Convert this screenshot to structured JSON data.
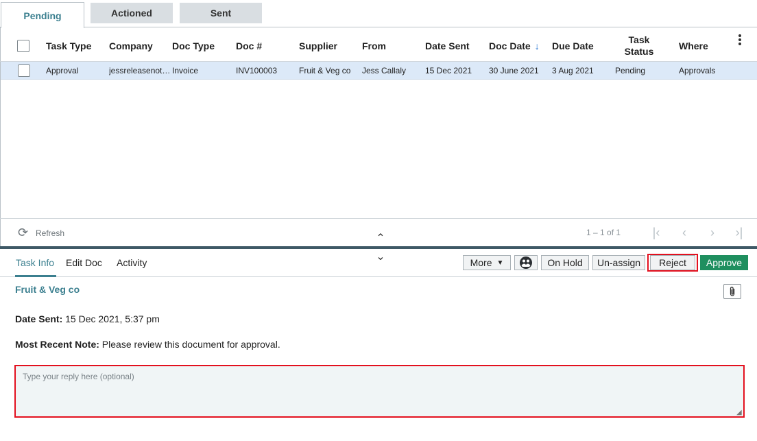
{
  "tabs": {
    "pending": "Pending",
    "actioned": "Actioned",
    "sent": "Sent"
  },
  "columns": {
    "task_type": "Task Type",
    "company": "Company",
    "doc_type": "Doc Type",
    "doc_num": "Doc #",
    "supplier": "Supplier",
    "from": "From",
    "date_sent": "Date Sent",
    "doc_date": "Doc Date",
    "due_date": "Due Date",
    "task_status_1": "Task",
    "task_status_2": "Status",
    "where": "Where",
    "sort_icon": "arrow-down-icon"
  },
  "rows": [
    {
      "task_type": "Approval",
      "company": "jessreleasenot…",
      "doc_type": "Invoice",
      "doc_num": "INV100003",
      "supplier": "Fruit & Veg co",
      "from": "Jess Callaly",
      "date_sent": "15 Dec 2021",
      "doc_date": "30 June 2021",
      "due_date": "3 Aug 2021",
      "task_status": "Pending",
      "where": "Approvals"
    }
  ],
  "pager": {
    "refresh_label": "Refresh",
    "count": "1 – 1 of 1"
  },
  "detail_tabs": {
    "task_info": "Task Info",
    "edit_doc": "Edit Doc",
    "activity": "Activity"
  },
  "actions": {
    "more": "More",
    "on_hold": "On Hold",
    "unassign": "Un-assign",
    "reject": "Reject",
    "approve": "Approve"
  },
  "detail": {
    "supplier_name": "Fruit & Veg co",
    "date_sent_label": "Date Sent:",
    "date_sent_value": "15 Dec 2021, 5:37 pm",
    "note_label": "Most Recent Note:",
    "note_value": "Please review this document for approval."
  },
  "reply": {
    "placeholder": "Type your reply here (optional)",
    "value": ""
  },
  "colors": {
    "accent": "#3b7f8f",
    "approve": "#1f8f5f",
    "highlight": "#e3101e",
    "row_selected": "#dce9f8"
  }
}
